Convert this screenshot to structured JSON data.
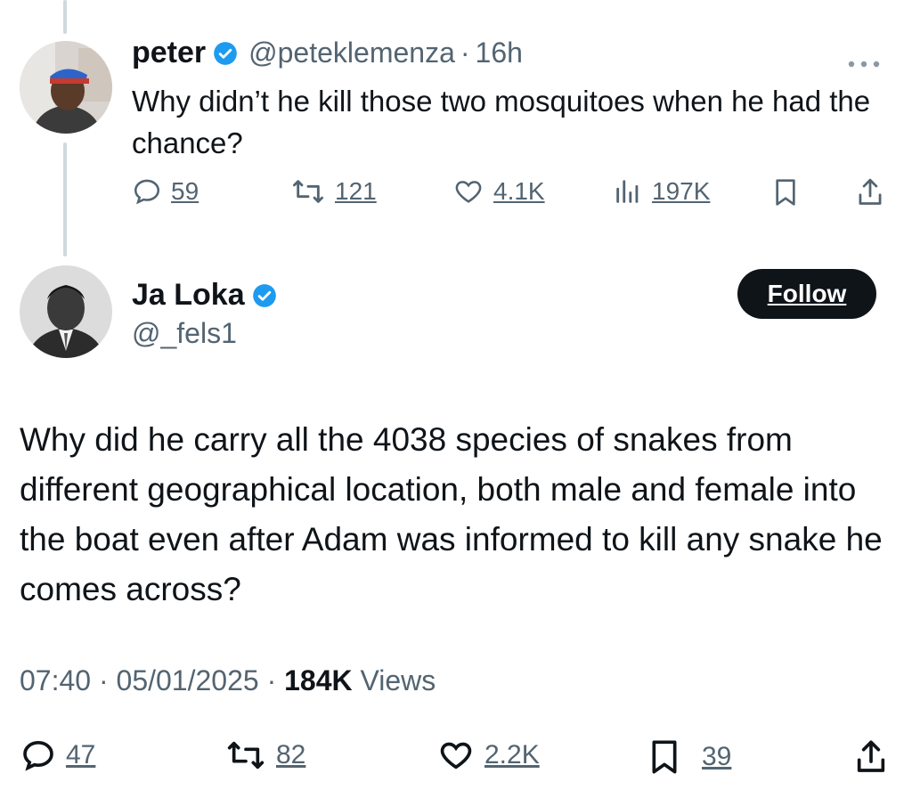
{
  "reply": {
    "name": "peter",
    "handle": "@peteklemenza",
    "separator": "·",
    "time": "16h",
    "more_icon": "more-horizontal-icon",
    "text": "Why didn’t he kill those two mosquitoes when he had the chance?",
    "stats": {
      "replies": "59",
      "reposts": "121",
      "likes": "4.1K",
      "views": "197K"
    }
  },
  "tweet": {
    "name": "Ja Loka",
    "handle": "@_fels1",
    "follow_label": "Follow",
    "text": "Why did he carry all the 4038 species of snakes from different geographical location, both male and female into the boat even after Adam was informed to kill any snake he comes across?",
    "time": "07:40",
    "date": "05/01/2025",
    "separator": "·",
    "views_count": "184K",
    "views_label": "Views",
    "stats": {
      "replies": "47",
      "reposts": "82",
      "likes": "2.2K",
      "bookmarks": "39"
    }
  },
  "colors": {
    "verified": "#1d9bf0",
    "text": "#0f1419",
    "muted": "#536471",
    "thread": "#cfd9de"
  }
}
